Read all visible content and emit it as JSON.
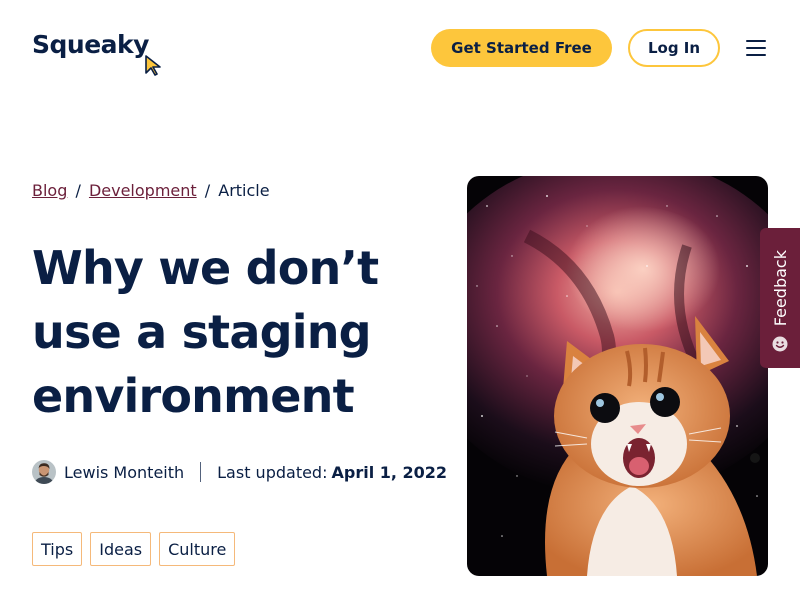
{
  "header": {
    "logo_text": "Squeaky",
    "get_started_label": "Get Started Free",
    "login_label": "Log In"
  },
  "breadcrumb": {
    "items": [
      {
        "label": "Blog"
      },
      {
        "label": "Development"
      }
    ],
    "current": "Article",
    "separator": "/"
  },
  "article": {
    "title": "Why we don’t use a staging environment",
    "author": "Lewis Monteith",
    "updated_label": "Last updated:",
    "updated_date": "April 1, 2022",
    "tags": [
      "Tips",
      "Ideas",
      "Culture"
    ]
  },
  "feedback": {
    "label": "Feedback"
  },
  "colors": {
    "accent_yellow": "#fdc63c",
    "navy": "#0a1f44",
    "maroon": "#6b1f3a",
    "tag_border": "#f5b97a"
  },
  "icons": {
    "menu": "hamburger-icon",
    "logo_cursor": "cursor-icon",
    "feedback": "smiley-icon"
  }
}
